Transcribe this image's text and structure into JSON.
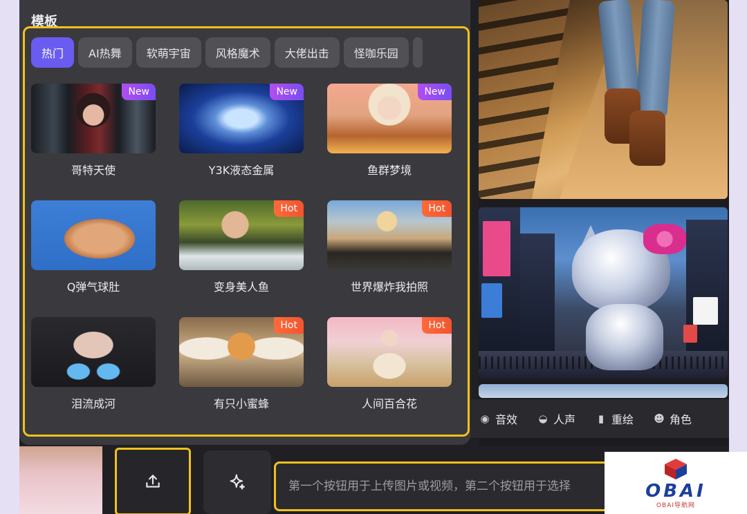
{
  "panel": {
    "title": "模板",
    "tabs": [
      "热门",
      "AI热舞",
      "软萌宇宙",
      "风格魔术",
      "大佬出击",
      "怪咖乐园"
    ],
    "active_tab": "热门",
    "cards": [
      {
        "label": "哥特天使",
        "badge": "New",
        "badge_type": "new"
      },
      {
        "label": "Y3K液态金属",
        "badge": "New",
        "badge_type": "new"
      },
      {
        "label": "鱼群梦境",
        "badge": "New",
        "badge_type": "new"
      },
      {
        "label": "Q弹气球肚",
        "badge": "",
        "badge_type": ""
      },
      {
        "label": "变身美人鱼",
        "badge": "Hot",
        "badge_type": "hot"
      },
      {
        "label": "世界爆炸我拍照",
        "badge": "Hot",
        "badge_type": "hot"
      },
      {
        "label": "泪流成河",
        "badge": "",
        "badge_type": ""
      },
      {
        "label": "有只小蜜蜂",
        "badge": "Hot",
        "badge_type": "hot"
      },
      {
        "label": "人间百合花",
        "badge": "Hot",
        "badge_type": "hot"
      }
    ]
  },
  "tools": {
    "sound_effect": "音效",
    "voice": "人声",
    "repaint": "重绘",
    "character": "角色"
  },
  "input": {
    "placeholder": "第一个按钮用于上传图片或视频，第二个按钮用于选择"
  },
  "watermark": {
    "brand": "OBAI",
    "sub": "OBAI导航网"
  },
  "colors": {
    "accent": "#6a5cf0",
    "highlight": "#f2c21b",
    "new_badge": "#9a4df2",
    "hot_badge": "#f45a33"
  }
}
